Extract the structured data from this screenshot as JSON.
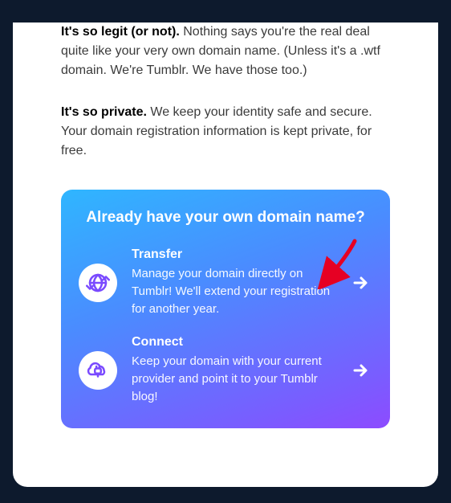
{
  "paragraphs": {
    "legit_bold": "It's so legit (or not).",
    "legit_text": " Nothing says you're the real deal quite like your very own domain name. (Unless it's a .wtf domain. We're Tumblr. We have those too.)",
    "private_bold": "It's so private.",
    "private_text": " We keep your identity safe and secure. Your domain registration information is kept private, for free."
  },
  "promo": {
    "title": "Already have your own domain name?",
    "actions": [
      {
        "title": "Transfer",
        "desc": "Manage your domain directly on Tumblr! We'll extend your registration for another year."
      },
      {
        "title": "Connect",
        "desc": "Keep your domain with your current provider and point it to your Tumblr blog!"
      }
    ]
  }
}
